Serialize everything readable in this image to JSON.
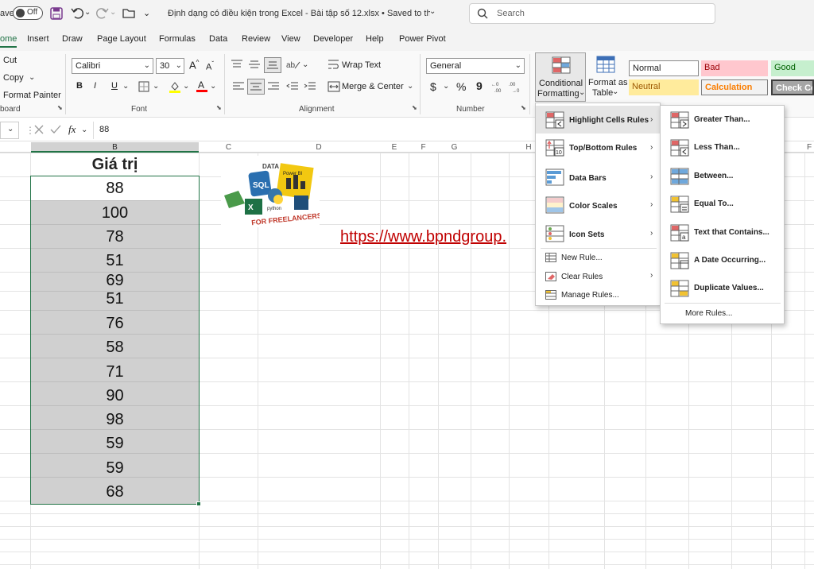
{
  "titlebar": {
    "autosave_label": "ave",
    "toggle_label": "Off",
    "document_title": "Định dạng có điều kiện trong Excel  -  Bài tập số 12.xlsx  •  Saved to this PC",
    "search_placeholder": "Search"
  },
  "tabs": [
    "ome",
    "Insert",
    "Draw",
    "Page Layout",
    "Formulas",
    "Data",
    "Review",
    "View",
    "Developer",
    "Help",
    "Power Pivot"
  ],
  "ribbon": {
    "clipboard": {
      "cut": "Cut",
      "copy": "Copy",
      "format_painter": "Format Painter",
      "group": "board"
    },
    "font": {
      "name": "Calibri",
      "size": "30",
      "bold": "B",
      "italic": "I",
      "underline": "U",
      "group": "Font",
      "grow": "A",
      "shrink": "A"
    },
    "alignment": {
      "wrap_text": "Wrap Text",
      "merge_center": "Merge & Center",
      "group": "Alignment"
    },
    "number": {
      "format": "General",
      "currency": "$",
      "percent": "%",
      "comma": "9",
      "group": "Number"
    },
    "styles": {
      "conditional_formatting": [
        "Conditional",
        "Formatting"
      ],
      "format_as_table": [
        "Format as",
        "Table"
      ],
      "normal": "Normal",
      "bad": "Bad",
      "good": "Good",
      "neutral": "Neutral",
      "calculation": "Calculation",
      "check_cell": "Check Cel"
    }
  },
  "formula_bar": {
    "value": "88",
    "fx": "fx"
  },
  "sheet": {
    "columns": [
      "B",
      "C",
      "D",
      "E",
      "F",
      "G",
      "H",
      "F"
    ],
    "header": "Giá trị",
    "values": [
      "88",
      "100",
      "78",
      "51",
      "69",
      "51",
      "76",
      "58",
      "71",
      "90",
      "98",
      "59",
      "59",
      "68"
    ],
    "logo": {
      "data": "DATA",
      "sql": "SQL",
      "power_bi": "Power BI",
      "python": "python",
      "caption": "FOR FREELANCERS"
    },
    "link": "https://www.bpndgroup."
  },
  "cf_menu": {
    "items": [
      {
        "label": "Highlight Cells Rules",
        "icon": "highlight-cells-icon"
      },
      {
        "label": "Top/Bottom Rules",
        "icon": "top-bottom-icon"
      },
      {
        "label": "Data Bars",
        "icon": "data-bars-icon"
      },
      {
        "label": "Color Scales",
        "icon": "color-scales-icon"
      },
      {
        "label": "Icon Sets",
        "icon": "icon-sets-icon"
      }
    ],
    "small_items": [
      "New Rule...",
      "Clear Rules",
      "Manage Rules..."
    ]
  },
  "highlight_submenu": {
    "items": [
      "Greater Than...",
      "Less Than...",
      "Between...",
      "Equal To...",
      "Text that Contains...",
      "A Date Occurring...",
      "Duplicate Values..."
    ],
    "more": "More Rules..."
  },
  "colors": {
    "accent": "#217346",
    "selection": "#d0d0d0",
    "link": "#c00000",
    "bad": "#ffc7ce",
    "good": "#c6efce",
    "neutral": "#ffeb9c"
  }
}
